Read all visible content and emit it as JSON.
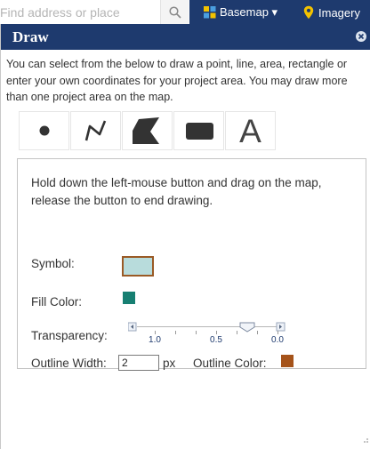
{
  "topbar": {
    "search_placeholder": "Find address or place",
    "basemap_label": "Basemap ▾",
    "imagery_label": "Imagery"
  },
  "panel": {
    "title": "Draw",
    "intro": "You can select from the below to draw a point, line, area, rectangle or enter your own coordinates for your project area. You may draw more than one project area on the map.",
    "tools": [
      {
        "icon": "point-icon"
      },
      {
        "icon": "polyline-icon"
      },
      {
        "icon": "polygon-icon"
      },
      {
        "icon": "rectangle-icon"
      },
      {
        "icon": "text-icon",
        "glyph": "A"
      }
    ],
    "hint": "Hold down the left-mouse button and drag on the map, release the button to end drawing.",
    "symbol_label": "Symbol:",
    "fill_color_label": "Fill Color:",
    "transparency_label": "Transparency:",
    "transparency_ticks": [
      "1.0",
      "0.5",
      "0.0"
    ],
    "transparency_value": 0.5,
    "outline_width_label": "Outline Width:",
    "outline_width_value": "2",
    "outline_width_unit": "px",
    "outline_color_label": "Outline Color:"
  },
  "colors": {
    "header_bg": "#1e3a6e",
    "symbol_fill": "#b8dcdc",
    "symbol_outline": "#9a5a25",
    "fill_color": "#177f72",
    "outline_color": "#a5531a"
  }
}
